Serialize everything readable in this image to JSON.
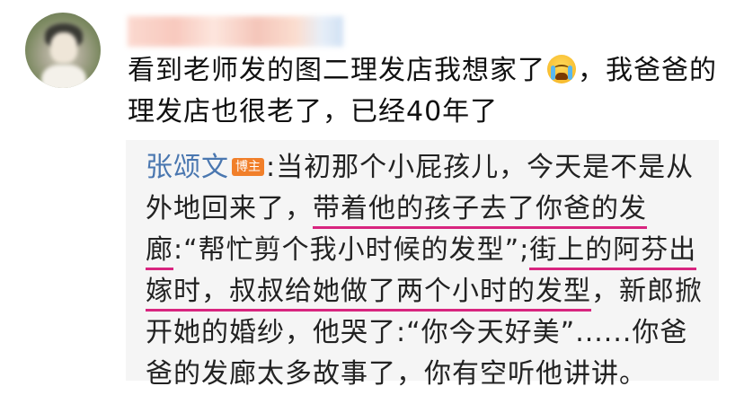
{
  "post": {
    "comment_part1": "看到老师发的图二理发店我想家了",
    "emoji_icon": "crying-face-emoji",
    "comment_part2": "，我爸爸的理发店也很老了，已经40年了"
  },
  "reply": {
    "author": "张颂文",
    "badge": "博主",
    "segments": [
      ":当初那个小屁孩儿，今天是不是从外地回来了，",
      "带着他的孩子去了你爸的发廊",
      ":“帮忙剪个我小时候的发型”;",
      "街上的阿芬出嫁时，叔叔给她做了两个小时的发型",
      "，新郎掀开她的婚纱，他哭了:“你今天好美”......你爸爸的发廊太多故事了，你有空听他讲讲。"
    ]
  },
  "colors": {
    "author": "#4a77b0",
    "badge_bg": "#f17f2a",
    "underline": "#d8257f",
    "reply_bg": "#f5f5f5"
  }
}
